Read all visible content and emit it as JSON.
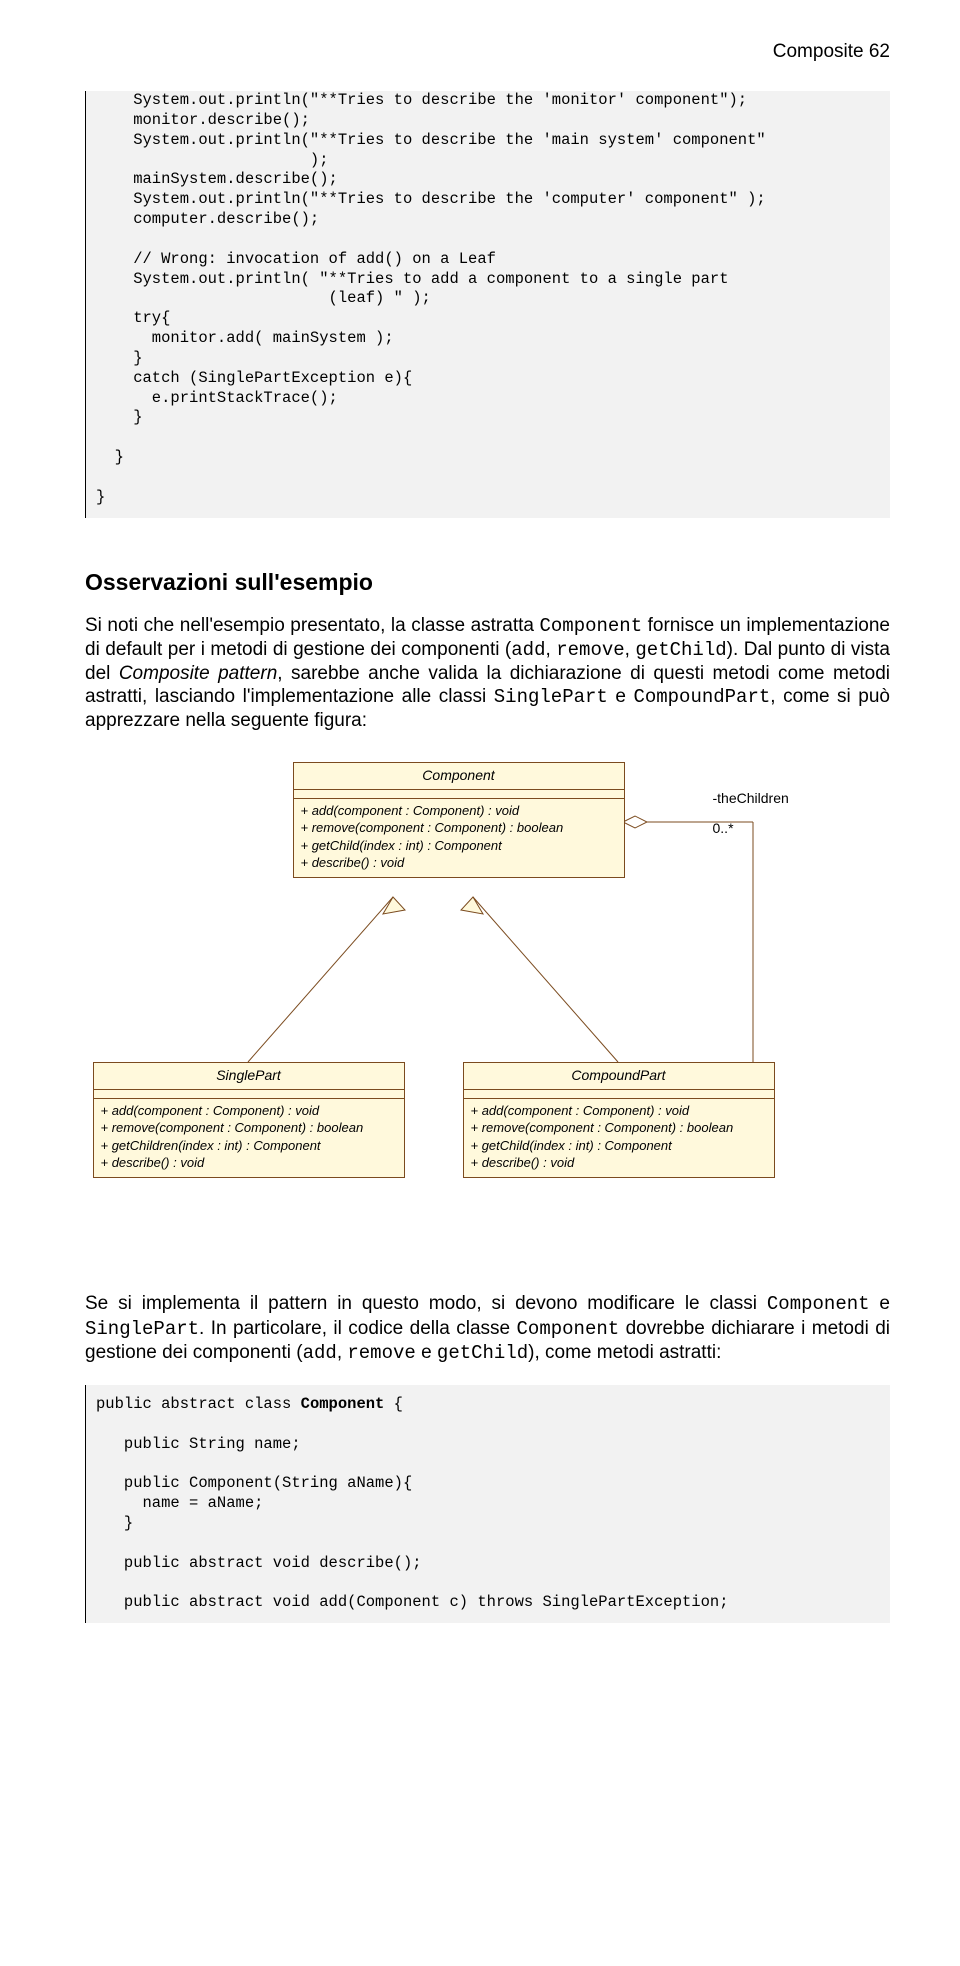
{
  "header": "Composite 62",
  "code1": "    System.out.println(\"**Tries to describe the 'monitor' component\");\n    monitor.describe();\n    System.out.println(\"**Tries to describe the 'main system' component\"\n                       );\n    mainSystem.describe();\n    System.out.println(\"**Tries to describe the 'computer' component\" );\n    computer.describe();\n\n    // Wrong: invocation of add() on a Leaf\n    System.out.println( \"**Tries to add a component to a single part\n                         (leaf) \" );\n    try{\n      monitor.add( mainSystem );\n    }\n    catch (SinglePartException e){\n      e.printStackTrace();\n    }\n\n  }\n\n}",
  "section_title": "Osservazioni sull'esempio",
  "para1_a": "Si noti che nell'esempio presentato, la classe astratta ",
  "para1_b": "Component",
  "para1_c": " fornisce un implementazione di default per i metodi di gestione dei componenti (",
  "para1_d": "add",
  "para1_e": ", ",
  "para1_f": "remove",
  "para1_g": ", ",
  "para1_h": "getChild",
  "para1_i": "). Dal punto di vista del ",
  "para1_j": "Composite pattern",
  "para1_k": ", sarebbe anche valida la dichiarazione di questi metodi come metodi astratti, lasciando l'implementazione alle classi ",
  "para1_l": "SinglePart",
  "para1_m": " e ",
  "para1_n": "CompoundPart",
  "para1_o": ", come si può apprezzare nella seguente figura:",
  "uml": {
    "component": {
      "title": "Component",
      "m1": "+ add(component : Component) : void",
      "m2": "+ remove(component : Component) : boolean",
      "m3": "+ getChild(index : int) : Component",
      "m4": "+ describe() : void"
    },
    "single": {
      "title": "SinglePart",
      "m1": "+ add(component : Component) : void",
      "m2": "+ remove(component : Component) : boolean",
      "m3": "+ getChildren(index : int) : Component",
      "m4": "+ describe() : void"
    },
    "compound": {
      "title": "CompoundPart",
      "m1": "+ add(component : Component) : void",
      "m2": "+ remove(component : Component) : boolean",
      "m3": "+ getChild(index : int) : Component",
      "m4": "+ describe() : void"
    },
    "assoc_role": "-theChildren",
    "assoc_mult": "0..*"
  },
  "para2_a": "Se si implementa il pattern in questo modo, si devono modificare le classi ",
  "para2_b": "Component",
  "para2_c": " e ",
  "para2_d": "SinglePart",
  "para2_e": ". In particolare, il codice della classe ",
  "para2_f": "Component",
  "para2_g": " dovrebbe dichiarare i metodi di gestione dei componenti (",
  "para2_h": "add",
  "para2_i": ", ",
  "para2_j": "remove",
  "para2_k": " e ",
  "para2_l": "getChild",
  "para2_m": "), come metodi astratti:",
  "code2_a": "public abstract class ",
  "code2_b": "Component",
  "code2_c": " {\n\n   public String name;\n\n   public Component(String aName){\n     name = aName;\n   }\n\n   public abstract void describe();\n\n   public abstract void add(Component c) throws SinglePartException;"
}
